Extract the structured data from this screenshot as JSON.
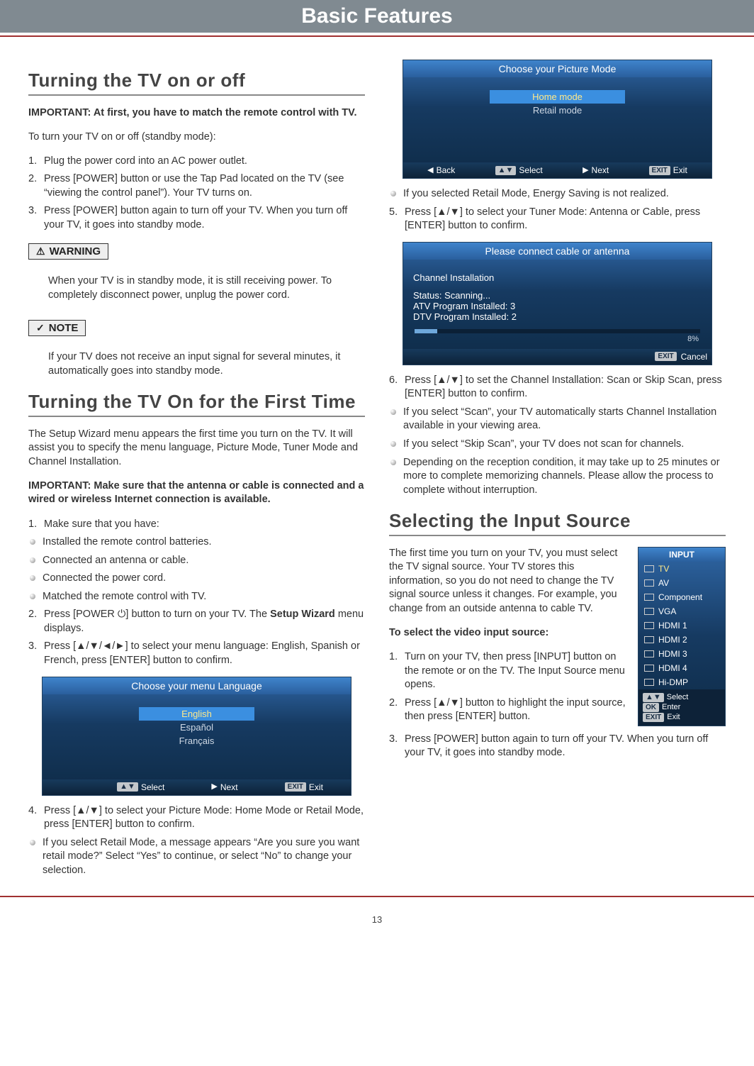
{
  "banner": "Basic Features",
  "page_number": "13",
  "s1": {
    "title": "Turning the TV on or off",
    "important": "IMPORTANT: At first, you have to match the remote control with TV.",
    "intro": "To turn your TV on or off (standby mode):",
    "steps": [
      "Plug the power cord into an AC power outlet.",
      "Press [POWER] button or use the Tap Pad located on the TV (see “viewing the control panel”). Your TV turns on.",
      "Press [POWER] button again to turn off your TV. When you turn off your TV, it goes into standby mode."
    ],
    "warning_label": "WARNING",
    "warning": "When your TV is in standby mode, it is still receiving power. To completely disconnect power, unplug the power cord.",
    "note_label": "NOTE",
    "note": "If your TV does not receive an input signal for several minutes, it automatically goes into standby mode."
  },
  "s2": {
    "title": "Turning the TV On for the First Time",
    "para1": "The Setup Wizard menu appears the first time you turn on the TV. It will assist you to specify the menu language, Picture Mode, Tuner Mode and Channel Installation.",
    "important": "IMPORTANT: Make sure that the antenna or cable is connected and a wired or wireless Internet connection is available.",
    "step1_lead": "Make sure that you have:",
    "checks": [
      "Installed the remote control batteries.",
      "Connected an antenna or cable.",
      "Connected the power cord.",
      "Matched the remote control with TV."
    ],
    "step2_a": "Press [POWER ⏻] button to turn on your TV. The ",
    "step2_b": "Setup Wizard",
    "step2_c": " menu displays.",
    "step3": "Press [▲/▼/◄/►] to select your menu language: English, Spanish or French, press [ENTER] button to confirm.",
    "step4": "Press [▲/▼] to select your Picture Mode: Home Mode or Retail Mode, press [ENTER] button to confirm.",
    "bullet4": "If you select Retail Mode, a message appears “Are you sure you want retail mode?” Select “Yes” to continue, or select “No” to change your selection.",
    "bullet5": "If you selected Retail Mode, Energy Saving is not realized.",
    "step5": "Press [▲/▼] to select your Tuner Mode: Antenna or Cable, press [ENTER] button to confirm.",
    "step6": "Press [▲/▼] to set the Channel Installation: Scan or Skip Scan, press [ENTER] button to confirm.",
    "post6": [
      "If you select “Scan”, your TV automatically starts Channel Installation available in your viewing area.",
      "If you select “Skip Scan”, your TV does not scan for channels.",
      "Depending on the reception condition, it may take up to 25 minutes or more to complete memorizing channels. Please allow the process to complete without interruption."
    ]
  },
  "osd_lang": {
    "title": "Choose your menu Language",
    "options": [
      "English",
      "Español",
      "Français"
    ],
    "selected": "English",
    "footer": {
      "select": "Select",
      "next": "Next",
      "exit": "Exit"
    }
  },
  "osd_picture": {
    "title": "Choose your Picture Mode",
    "options": [
      "Home mode",
      "Retail mode"
    ],
    "selected": "Home mode",
    "footer": {
      "back": "Back",
      "select": "Select",
      "next": "Next",
      "exit": "Exit"
    }
  },
  "osd_channel": {
    "title": "Please connect cable or antenna",
    "heading": "Channel Installation",
    "lines": [
      "Status: Scanning...",
      "ATV Program Installed: 3",
      "DTV Program Installed: 2"
    ],
    "progress": "8%",
    "cancel": "Cancel"
  },
  "s3": {
    "title": "Selecting the Input Source",
    "para": "The first time you turn on your TV, you must select the TV signal source. Your TV stores this information, so you do not need to change the TV signal source unless it changes. For example, you change from an outside antenna to cable TV.",
    "subhead": "To select the video input source:",
    "steps": [
      "Turn on your TV, then press [INPUT] button on the remote or on the TV. The Input Source menu opens.",
      "Press [▲/▼] button to highlight the input source, then press [ENTER] button.",
      "Press [POWER] button again to turn off your TV. When you turn off your TV, it goes into standby mode."
    ]
  },
  "input_menu": {
    "title": "INPUT",
    "items": [
      "TV",
      "AV",
      "Component",
      "VGA",
      "HDMI 1",
      "HDMI 2",
      "HDMI 3",
      "HDMI 4",
      "Hi-DMP"
    ],
    "selected": "TV",
    "footer": {
      "select": "Select",
      "enter": "Enter",
      "exit": "Exit"
    }
  },
  "labels": {
    "exit_pill": "EXIT",
    "ok_pill": "OK"
  }
}
